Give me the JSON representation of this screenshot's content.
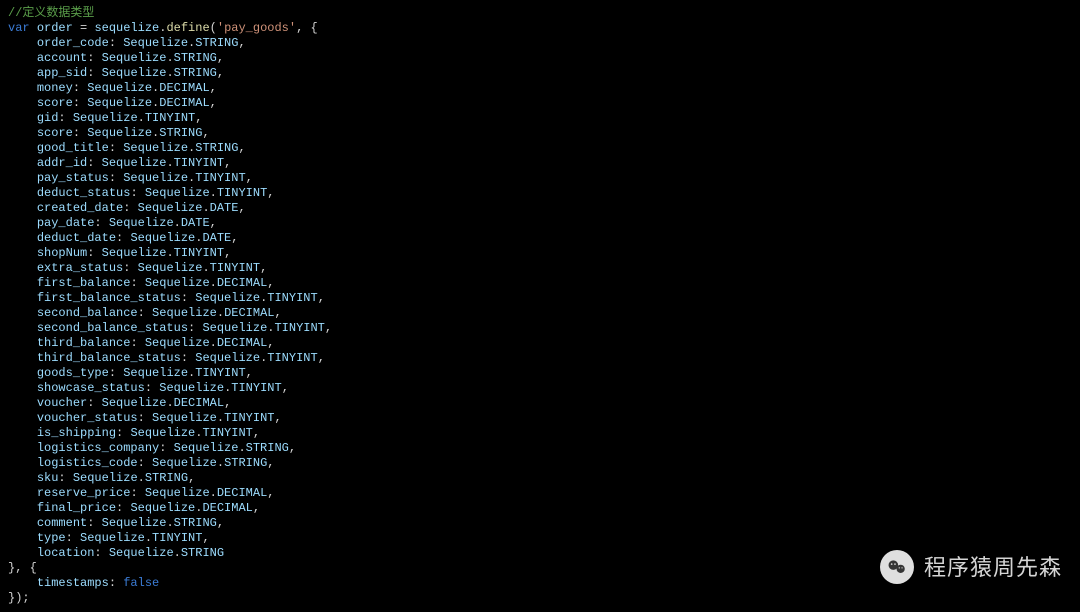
{
  "code": {
    "comment": "//定义数据类型",
    "var_kw": "var",
    "var_name": "order",
    "assign": " = ",
    "obj": "sequelize",
    "method": "define",
    "model_name": "pay_goods",
    "fields": [
      {
        "name": "order_code",
        "type": "STRING"
      },
      {
        "name": "account",
        "type": "STRING"
      },
      {
        "name": "app_sid",
        "type": "STRING"
      },
      {
        "name": "money",
        "type": "DECIMAL"
      },
      {
        "name": "score",
        "type": "DECIMAL"
      },
      {
        "name": "gid",
        "type": "TINYINT"
      },
      {
        "name": "score",
        "type": "STRING"
      },
      {
        "name": "good_title",
        "type": "STRING"
      },
      {
        "name": "addr_id",
        "type": "TINYINT"
      },
      {
        "name": "pay_status",
        "type": "TINYINT"
      },
      {
        "name": "deduct_status",
        "type": "TINYINT"
      },
      {
        "name": "created_date",
        "type": "DATE"
      },
      {
        "name": "pay_date",
        "type": "DATE"
      },
      {
        "name": "deduct_date",
        "type": "DATE"
      },
      {
        "name": "shopNum",
        "type": "TINYINT"
      },
      {
        "name": "extra_status",
        "type": "TINYINT"
      },
      {
        "name": "first_balance",
        "type": "DECIMAL"
      },
      {
        "name": "first_balance_status",
        "type": "TINYINT"
      },
      {
        "name": "second_balance",
        "type": "DECIMAL"
      },
      {
        "name": "second_balance_status",
        "type": "TINYINT"
      },
      {
        "name": "third_balance",
        "type": "DECIMAL"
      },
      {
        "name": "third_balance_status",
        "type": "TINYINT"
      },
      {
        "name": "goods_type",
        "type": "TINYINT"
      },
      {
        "name": "showcase_status",
        "type": "TINYINT"
      },
      {
        "name": "voucher",
        "type": "DECIMAL"
      },
      {
        "name": "voucher_status",
        "type": "TINYINT"
      },
      {
        "name": "is_shipping",
        "type": "TINYINT"
      },
      {
        "name": "logistics_company",
        "type": "STRING"
      },
      {
        "name": "logistics_code",
        "type": "STRING"
      },
      {
        "name": "sku",
        "type": "STRING"
      },
      {
        "name": "reserve_price",
        "type": "DECIMAL"
      },
      {
        "name": "final_price",
        "type": "DECIMAL"
      },
      {
        "name": "comment",
        "type": "STRING"
      },
      {
        "name": "type",
        "type": "TINYINT"
      },
      {
        "name": "location",
        "type": "STRING"
      }
    ],
    "options": {
      "key": "timestamps",
      "value": "false"
    },
    "seq_class": "Sequelize"
  },
  "watermark": {
    "text": "程序猿周先森"
  }
}
